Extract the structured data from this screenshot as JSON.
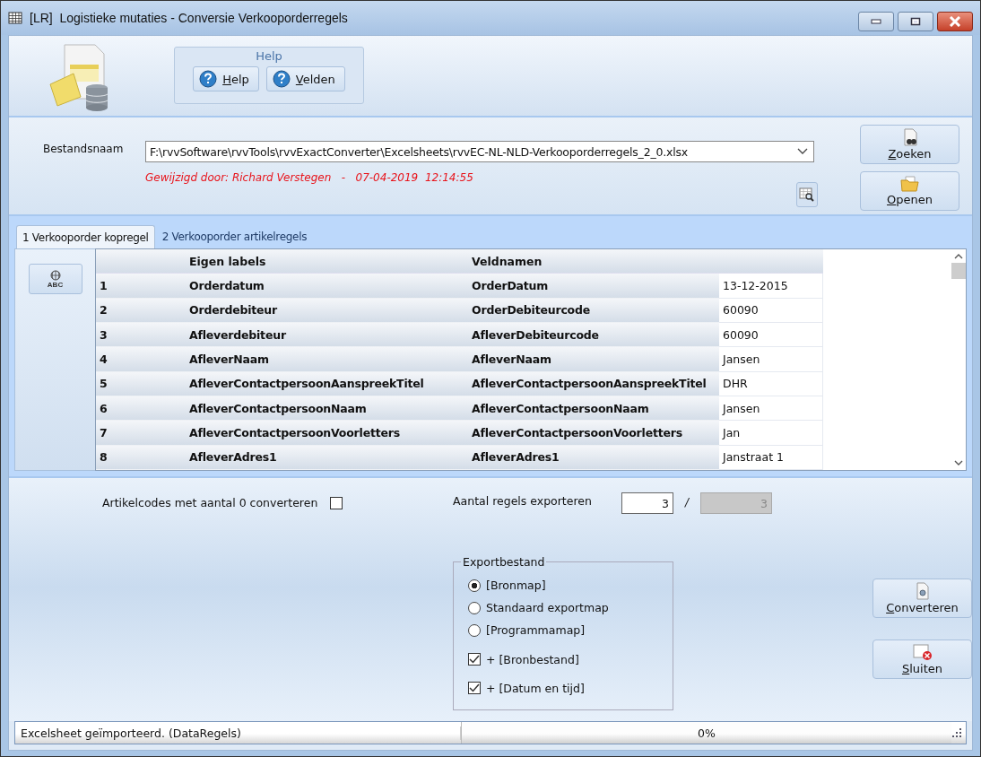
{
  "window": {
    "title": "[LR]  Logistieke mutaties - Conversie Verkooporderregels"
  },
  "help_group": {
    "title": "Help",
    "buttons": [
      "Help",
      "Velden"
    ]
  },
  "file": {
    "label": "Bestandsnaam",
    "value": "F:\\rvvSoftware\\rvvTools\\rvvExactConverter\\Excelsheets\\rvvEC-NL-NLD-Verkooporderregels_2_0.xlsx",
    "modified_note": "Gewijzigd door: Richard Verstegen   -   07-04-2019  12:14:55"
  },
  "file_buttons": [
    "Zoeken",
    "Openen"
  ],
  "tabs": [
    {
      "label": "1 Verkooporder kopregel",
      "selected": true
    },
    {
      "label": "2 Verkooporder artikelregels",
      "selected": false
    }
  ],
  "abc_button": "ABC",
  "table": {
    "columns": [
      "Eigen labels",
      "Veldnamen"
    ],
    "rows": [
      {
        "number": "1",
        "label": "Orderdatum",
        "field": "OrderDatum",
        "value": "13-12-2015"
      },
      {
        "number": "2",
        "label": "Orderdebiteur",
        "field": "OrderDebiteurcode",
        "value": "60090"
      },
      {
        "number": "3",
        "label": "Afleverdebiteur",
        "field": "AfleverDebiteurcode",
        "value": "60090"
      },
      {
        "number": "4",
        "label": "AfleverNaam",
        "field": "AfleverNaam",
        "value": "Jansen"
      },
      {
        "number": "5",
        "label": "AfleverContactpersoonAanspreekTitel",
        "field": "AfleverContactpersoonAanspreekTitel",
        "value": "DHR"
      },
      {
        "number": "6",
        "label": "AfleverContactpersoonNaam",
        "field": "AfleverContactpersoonNaam",
        "value": "Jansen"
      },
      {
        "number": "7",
        "label": "AfleverContactpersoonVoorletters",
        "field": "AfleverContactpersoonVoorletters",
        "value": "Jan"
      },
      {
        "number": "8",
        "label": "AfleverAdres1",
        "field": "AfleverAdres1",
        "value": "Janstraat 1"
      }
    ]
  },
  "zero_quantity": {
    "label": "Artikelcodes met aantal 0 converteren",
    "checked": false
  },
  "export_count": {
    "label": "Aantal regels exporteren",
    "value": "3",
    "separator": "/",
    "total": "3"
  },
  "export_file": {
    "title": "Exportbestand",
    "locations": [
      {
        "label": "[Bronmap]",
        "selected": true
      },
      {
        "label": "Standaard exportmap",
        "selected": false
      },
      {
        "label": "[Programmamap]",
        "selected": false
      }
    ],
    "suffixes": [
      {
        "label": "+ [Bronbestand]",
        "checked": true
      },
      {
        "label": "+ [Datum en tijd]",
        "checked": true
      }
    ]
  },
  "action_buttons": [
    {
      "kind": "convert",
      "label": "Converteren"
    },
    {
      "kind": "close",
      "label": "Sluiten"
    }
  ],
  "status_bar": {
    "message": "Excelsheet geïmporteerd. (DataRegels)",
    "progress_text": "0%",
    "level": 0
  }
}
